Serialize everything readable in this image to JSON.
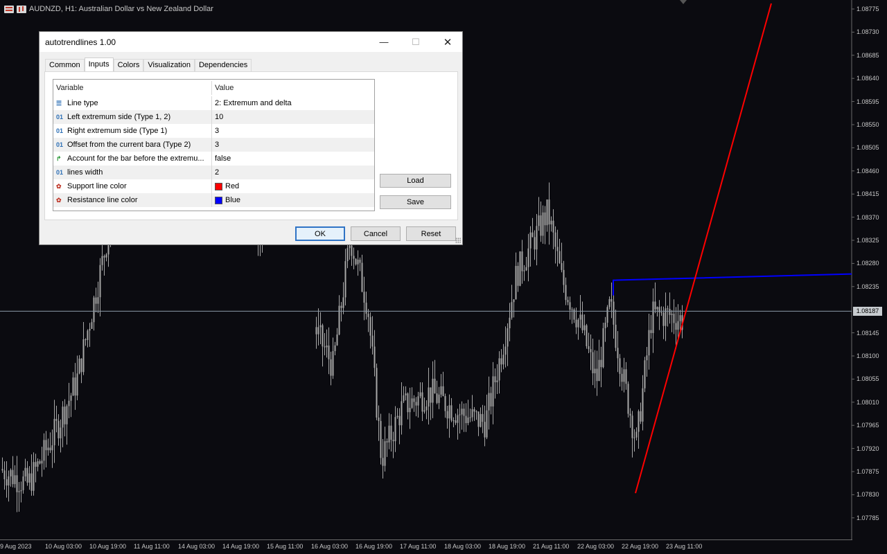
{
  "chart": {
    "symbol_title": "AUDNZD, H1:  Australian Dollar vs New Zealand Dollar",
    "current_price": "1.08187",
    "price_labels": [
      "1.08775",
      "1.08730",
      "1.08685",
      "1.08640",
      "1.08595",
      "1.08550",
      "1.08505",
      "1.08460",
      "1.08415",
      "1.08370",
      "1.08325",
      "1.08280",
      "1.08235",
      "1.08145",
      "1.08100",
      "1.08055",
      "1.08010",
      "1.07965",
      "1.07920",
      "1.07875",
      "1.07830",
      "1.07785"
    ],
    "time_labels": [
      "9 Aug 2023",
      "10 Aug 03:00",
      "10 Aug 19:00",
      "11 Aug 11:00",
      "14 Aug 03:00",
      "14 Aug 19:00",
      "15 Aug 11:00",
      "16 Aug 03:00",
      "16 Aug 19:00",
      "17 Aug 11:00",
      "18 Aug 03:00",
      "18 Aug 19:00",
      "21 Aug 11:00",
      "22 Aug 03:00",
      "22 Aug 19:00",
      "23 Aug 11:00"
    ],
    "colors": {
      "background": "#0b0b10",
      "candle": "#a8a8a8",
      "support_line": "#ff0000",
      "resistance_line": "#0000ff",
      "crosshair": "#8a9aa8"
    },
    "resistance_line_price": "1.08250",
    "support_line_start_price": "1.07860"
  },
  "dialog": {
    "title": "autotrendlines 1.00",
    "tabs": [
      "Common",
      "Inputs",
      "Colors",
      "Visualization",
      "Dependencies"
    ],
    "active_tab": "Inputs",
    "columns": {
      "variable": "Variable",
      "value": "Value"
    },
    "rows": [
      {
        "icon": "line-type-icon",
        "name": "Line type",
        "value": "2: Extremum and delta"
      },
      {
        "icon": "integer-icon",
        "name": "Left extremum side (Type 1, 2)",
        "value": "10"
      },
      {
        "icon": "integer-icon",
        "name": "Right extremum side (Type 1)",
        "value": "3"
      },
      {
        "icon": "integer-icon",
        "name": "Offset from the current bara (Type 2)",
        "value": "3"
      },
      {
        "icon": "boolean-icon",
        "name": "Account for the bar before the extremu...",
        "value": "false"
      },
      {
        "icon": "integer-icon",
        "name": "lines width",
        "value": "2"
      },
      {
        "icon": "color-icon",
        "name": "Support line color",
        "value": "Red",
        "swatch": "#ff0000"
      },
      {
        "icon": "color-icon",
        "name": "Resistance line color",
        "value": "Blue",
        "swatch": "#0000ff"
      }
    ],
    "buttons": {
      "load": "Load",
      "save": "Save",
      "ok": "OK",
      "cancel": "Cancel",
      "reset": "Reset"
    },
    "window_controls": {
      "minimize": "—",
      "maximize": "☐",
      "close": "✕"
    }
  }
}
